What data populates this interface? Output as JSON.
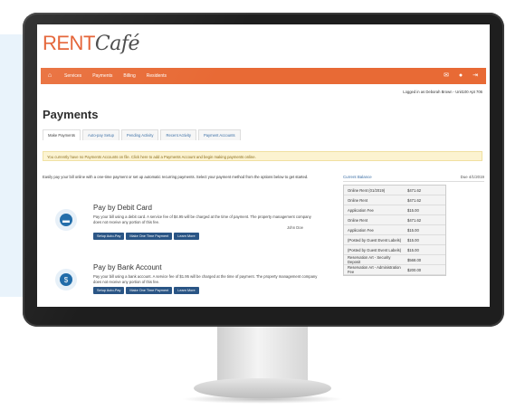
{
  "brand": {
    "rent": "RENT",
    "cafe": "Café"
  },
  "nav": {
    "items": [
      "Services",
      "Payments",
      "Billing",
      "Residents"
    ],
    "right_icons": [
      "mail-icon",
      "user-icon",
      "logout-icon"
    ]
  },
  "logged_in_text": "Logged in as Deborah Brown - Unit100 Apt 706",
  "page_title": "Payments",
  "tabs": [
    "Make Payments",
    "Auto-pay Setup",
    "Pending Activity",
    "Recent Activity",
    "Payment Accounts"
  ],
  "notice": "You currently have no Payments Accounts on file. Click here to add a Payments Account and begin making payments online.",
  "intro": "Easily pay your bill online with a one-time payment or set up automatic recurring payments. Select your payment method from the options below to get started.",
  "methods": [
    {
      "title": "Pay by Debit Card",
      "desc": "Pay your bill using a debit card. A service fee of $4.95 will be charged at the time of payment. The property management company does not receive any portion of this fee.",
      "signer": "John Doe",
      "buttons": [
        "Setup Auto-Pay",
        "Make One Time Payment",
        "Learn More"
      ],
      "icon": "credit-card-icon"
    },
    {
      "title": "Pay by Bank Account",
      "desc": "Pay your bill using a bank account. A service fee of $1.95 will be charged at the time of payment. The property management company does not receive any portion of this fee.",
      "buttons": [
        "Setup Auto-Pay",
        "Make One Time Payment",
        "Learn More"
      ],
      "icon": "bank-icon"
    }
  ],
  "balance": {
    "title": "Current Balance",
    "date": "Due 4/1/2019",
    "rows": [
      {
        "k": "Online Rent (01/2019)",
        "v": "$471.62"
      },
      {
        "k": "Online Rent",
        "v": "$471.62"
      },
      {
        "k": "Application Fee",
        "v": "$15.00"
      },
      {
        "k": "Online Rent",
        "v": "$471.62"
      },
      {
        "k": "Application Fee",
        "v": "$15.00"
      },
      {
        "k": "(Posted by Guest Event Labels)",
        "v": "$15.00"
      },
      {
        "k": "(Posted by Guest Event Labels)",
        "v": "$15.00"
      },
      {
        "k": "Reservation Art - Security Deposit",
        "v": "$568.00"
      },
      {
        "k": "Reservation Art - Administration Fee",
        "v": "$200.00"
      }
    ]
  }
}
